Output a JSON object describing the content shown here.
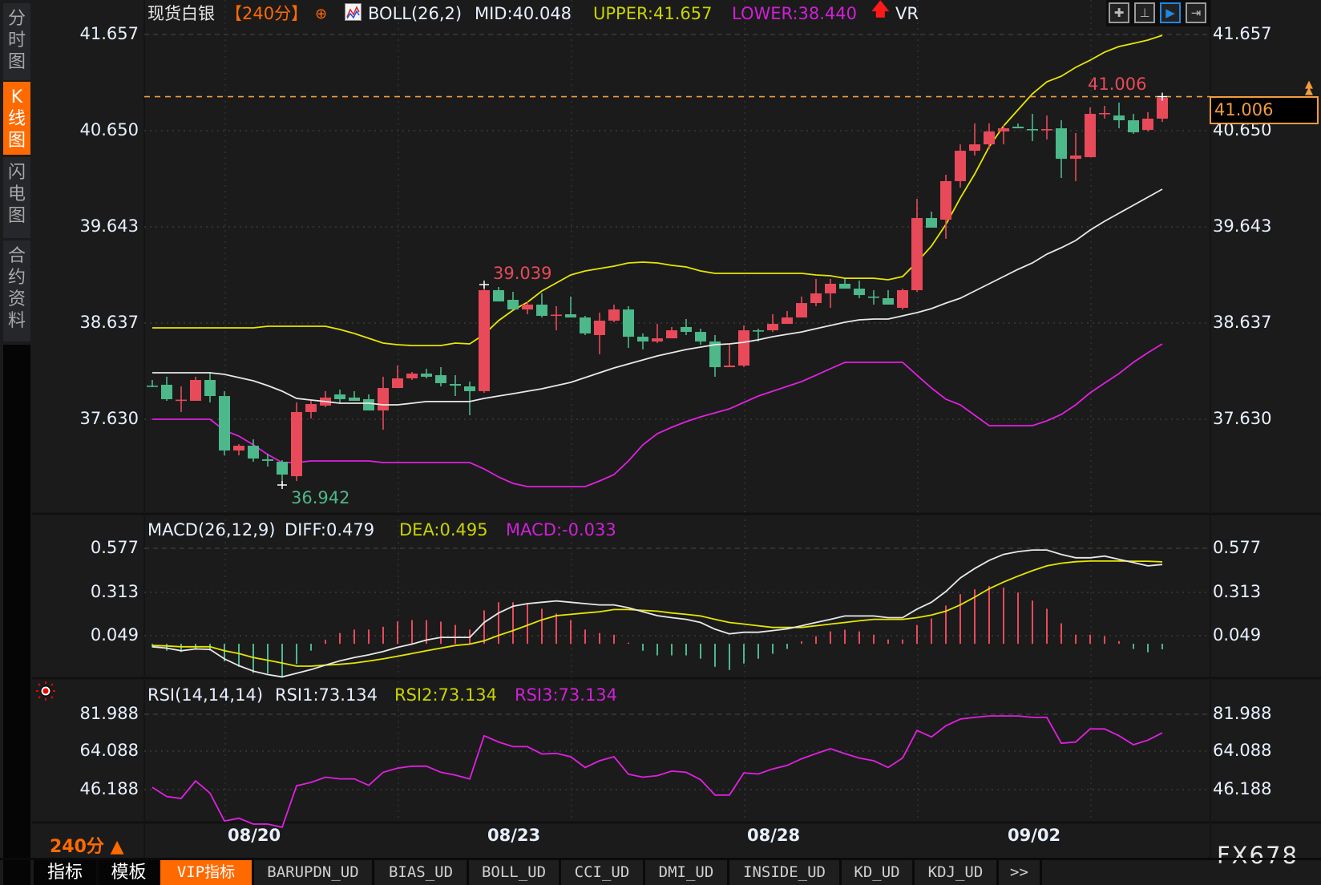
{
  "sidebar": {
    "tabs": [
      {
        "label": "分时图",
        "active": false
      },
      {
        "label": "K线图",
        "active": true
      },
      {
        "label": "闪电图",
        "active": false
      },
      {
        "label": "合约资料",
        "active": false
      }
    ]
  },
  "header": {
    "symbol": "现货白银",
    "period": "【240分】",
    "indicator": "BOLL(26,2)",
    "mid": "MID:40.048",
    "upper": "UPPER:41.657",
    "lower": "LOWER:38.440",
    "extra": "VR"
  },
  "toolbar_icons": [
    "crosshair-icon",
    "zoom-fit-icon",
    "auto-scroll-icon",
    "move-right-icon"
  ],
  "toolbar_active": 2,
  "price_tag": "41.006",
  "colors": {
    "background": "#1b1b1b",
    "up": "#e84a5a",
    "down": "#4db88a",
    "mid": "#e8e8e8",
    "upper": "#e6e600",
    "lower": "#e020e0",
    "accent": "#ff6a00",
    "price_line": "#f39c3c"
  },
  "macd_header": {
    "name": "MACD(26,12,9)",
    "diff": "DIFF:0.479",
    "dea": "DEA:0.495",
    "macd": "MACD:-0.033"
  },
  "rsi_header": {
    "name": "RSI(14,14,14)",
    "rsi1": "RSI1:73.134",
    "rsi2": "RSI2:73.134",
    "rsi3": "RSI3:73.134"
  },
  "chart_data": [
    {
      "type": "candlestick",
      "price_ticks": [
        "41.657",
        "40.650",
        "39.643",
        "38.637",
        "37.630"
      ],
      "ylim": [
        37.63,
        41.657
      ],
      "x_labels": [
        "08/20",
        "08/23",
        "08/28",
        "09/02"
      ],
      "last_price": 41.006,
      "annotations": {
        "high_1": "39.039",
        "low": "36.942",
        "high_2": "41.006"
      },
      "candles": [
        [
          37.982,
          38.041,
          37.966,
          37.975
        ],
        [
          37.991,
          38.075,
          37.823,
          37.84
        ],
        [
          37.831,
          37.974,
          37.706,
          37.835
        ],
        [
          37.823,
          38.075,
          37.823,
          38.041
        ],
        [
          38.041,
          38.125,
          37.806,
          37.873
        ],
        [
          37.873,
          37.924,
          37.252,
          37.303
        ],
        [
          37.303,
          37.37,
          37.252,
          37.353
        ],
        [
          37.353,
          37.42,
          37.185,
          37.219
        ],
        [
          37.211,
          37.269,
          37.135,
          37.194
        ],
        [
          37.185,
          37.202,
          36.942,
          37.051
        ],
        [
          37.034,
          37.806,
          36.984,
          37.706
        ],
        [
          37.706,
          37.823,
          37.638,
          37.789
        ],
        [
          37.773,
          37.924,
          37.756,
          37.857
        ],
        [
          37.89,
          37.94,
          37.806,
          37.84
        ],
        [
          37.857,
          37.924,
          37.823,
          37.823
        ],
        [
          37.84,
          37.89,
          37.722,
          37.722
        ],
        [
          37.722,
          38.075,
          37.521,
          37.957
        ],
        [
          37.957,
          38.192,
          37.957,
          38.058
        ],
        [
          38.058,
          38.125,
          38.041,
          38.108
        ],
        [
          38.108,
          38.159,
          38.058,
          38.075
        ],
        [
          38.091,
          38.175,
          37.974,
          38.008
        ],
        [
          37.999,
          38.091,
          37.873,
          37.982
        ],
        [
          37.974,
          38.024,
          37.672,
          37.924
        ],
        [
          37.924,
          39.039,
          37.907,
          38.981
        ],
        [
          38.981,
          39.014,
          38.863,
          38.863
        ],
        [
          38.88,
          38.964,
          38.779,
          38.779
        ],
        [
          38.779,
          38.863,
          38.729,
          38.83
        ],
        [
          38.83,
          38.947,
          38.695,
          38.712
        ],
        [
          38.721,
          38.813,
          38.561,
          38.725
        ],
        [
          38.729,
          38.914,
          38.695,
          38.695
        ],
        [
          38.695,
          38.712,
          38.511,
          38.528
        ],
        [
          38.511,
          38.746,
          38.31,
          38.662
        ],
        [
          38.662,
          38.83,
          38.645,
          38.779
        ],
        [
          38.779,
          38.813,
          38.377,
          38.494
        ],
        [
          38.494,
          38.528,
          38.36,
          38.444
        ],
        [
          38.444,
          38.628,
          38.427,
          38.477
        ],
        [
          38.477,
          38.595,
          38.477,
          38.561
        ],
        [
          38.595,
          38.679,
          38.511,
          38.544
        ],
        [
          38.544,
          38.578,
          38.41,
          38.444
        ],
        [
          38.444,
          38.511,
          38.075,
          38.175
        ],
        [
          38.175,
          38.41,
          38.175,
          38.192
        ],
        [
          38.192,
          38.612,
          38.175,
          38.561
        ],
        [
          38.561,
          38.578,
          38.444,
          38.553
        ],
        [
          38.561,
          38.729,
          38.544,
          38.628
        ],
        [
          38.628,
          38.763,
          38.628,
          38.695
        ],
        [
          38.695,
          38.914,
          38.695,
          38.846
        ],
        [
          38.846,
          39.098,
          38.813,
          38.947
        ],
        [
          38.947,
          39.098,
          38.796,
          39.048
        ],
        [
          39.048,
          39.098,
          38.997,
          38.997
        ],
        [
          38.997,
          39.081,
          38.897,
          38.93
        ],
        [
          38.914,
          38.981,
          38.83,
          38.91
        ],
        [
          38.897,
          38.981,
          38.83,
          38.83
        ],
        [
          38.796,
          38.997,
          38.779,
          38.981
        ],
        [
          38.981,
          39.937,
          38.964,
          39.736
        ],
        [
          39.736,
          39.803,
          39.635,
          39.635
        ],
        [
          39.719,
          40.189,
          39.518,
          40.122
        ],
        [
          40.122,
          40.507,
          40.054,
          40.44
        ],
        [
          40.44,
          40.726,
          40.39,
          40.507
        ],
        [
          40.507,
          40.726,
          40.457,
          40.642
        ],
        [
          40.642,
          40.709,
          40.507,
          40.675
        ],
        [
          40.692,
          40.726,
          40.675,
          40.675
        ],
        [
          40.667,
          40.826,
          40.541,
          40.662
        ],
        [
          40.662,
          40.809,
          40.558,
          40.667
        ],
        [
          40.675,
          40.759,
          40.155,
          40.356
        ],
        [
          40.356,
          40.625,
          40.122,
          40.39
        ],
        [
          40.373,
          40.893,
          40.373,
          40.826
        ],
        [
          40.83,
          40.91,
          40.776,
          40.835
        ],
        [
          40.809,
          40.944,
          40.675,
          40.759
        ],
        [
          40.759,
          40.826,
          40.617,
          40.633
        ],
        [
          40.658,
          40.843,
          40.642,
          40.776
        ],
        [
          40.776,
          41.006,
          40.742,
          40.994
        ]
      ],
      "boll_upper": [
        38.586,
        38.586,
        38.586,
        38.586,
        38.586,
        38.586,
        38.586,
        38.586,
        38.603,
        38.603,
        38.603,
        38.603,
        38.603,
        38.57,
        38.528,
        38.477,
        38.427,
        38.41,
        38.402,
        38.402,
        38.402,
        38.427,
        38.419,
        38.519,
        38.662,
        38.771,
        38.855,
        38.972,
        39.056,
        39.14,
        39.182,
        39.207,
        39.232,
        39.266,
        39.274,
        39.266,
        39.241,
        39.224,
        39.182,
        39.157,
        39.157,
        39.157,
        39.157,
        39.157,
        39.157,
        39.157,
        39.14,
        39.132,
        39.106,
        39.106,
        39.106,
        39.09,
        39.123,
        39.274,
        39.442,
        39.669,
        39.945,
        40.197,
        40.482,
        40.7,
        40.868,
        41.036,
        41.162,
        41.22,
        41.313,
        41.388,
        41.472,
        41.531,
        41.564,
        41.598,
        41.648
      ],
      "boll_mid": [
        38.117,
        38.117,
        38.117,
        38.117,
        38.117,
        38.1,
        38.066,
        38.033,
        37.982,
        37.924,
        37.848,
        37.831,
        37.815,
        37.798,
        37.798,
        37.798,
        37.781,
        37.781,
        37.798,
        37.815,
        37.815,
        37.815,
        37.815,
        37.848,
        37.873,
        37.898,
        37.924,
        37.949,
        37.982,
        38.016,
        38.066,
        38.117,
        38.167,
        38.209,
        38.251,
        38.293,
        38.326,
        38.36,
        38.385,
        38.41,
        38.419,
        38.435,
        38.461,
        38.494,
        38.519,
        38.544,
        38.578,
        38.612,
        38.645,
        38.67,
        38.679,
        38.679,
        38.712,
        38.746,
        38.788,
        38.846,
        38.897,
        38.972,
        39.048,
        39.123,
        39.199,
        39.266,
        39.358,
        39.425,
        39.501,
        39.61,
        39.702,
        39.786,
        39.87,
        39.954,
        40.038
      ],
      "boll_lower": [
        37.63,
        37.63,
        37.63,
        37.63,
        37.63,
        37.513,
        37.454,
        37.362,
        37.261,
        37.177,
        37.177,
        37.194,
        37.194,
        37.194,
        37.194,
        37.194,
        37.177,
        37.177,
        37.177,
        37.177,
        37.177,
        37.177,
        37.177,
        37.11,
        37.026,
        36.959,
        36.925,
        36.925,
        36.925,
        36.925,
        36.925,
        36.984,
        37.051,
        37.194,
        37.362,
        37.479,
        37.546,
        37.605,
        37.655,
        37.697,
        37.739,
        37.806,
        37.873,
        37.924,
        37.974,
        38.024,
        38.091,
        38.159,
        38.226,
        38.226,
        38.226,
        38.226,
        38.226,
        38.091,
        37.957,
        37.84,
        37.781,
        37.672,
        37.563,
        37.563,
        37.563,
        37.563,
        37.613,
        37.68,
        37.781,
        37.907,
        38.008,
        38.108,
        38.226,
        38.326,
        38.419
      ]
    },
    {
      "type": "bar",
      "name": "MACD(26,12,9)",
      "ticks": [
        "0.577",
        "0.313",
        "0.049"
      ],
      "macd": [
        -0.021,
        -0.041,
        -0.049,
        -0.033,
        -0.041,
        -0.106,
        -0.139,
        -0.176,
        -0.179,
        -0.204,
        -0.122,
        -0.041,
        0.024,
        0.065,
        0.086,
        0.086,
        0.103,
        0.135,
        0.143,
        0.143,
        0.134,
        0.114,
        0.086,
        0.202,
        0.251,
        0.251,
        0.241,
        0.212,
        0.183,
        0.143,
        0.086,
        0.065,
        0.055,
        0.007,
        -0.042,
        -0.07,
        -0.07,
        -0.07,
        -0.09,
        -0.139,
        -0.158,
        -0.119,
        -0.09,
        -0.06,
        -0.031,
        0.015,
        0.046,
        0.075,
        0.085,
        0.075,
        0.055,
        0.026,
        0.026,
        0.114,
        0.153,
        0.231,
        0.3,
        0.329,
        0.349,
        0.339,
        0.31,
        0.261,
        0.212,
        0.124,
        0.055,
        0.055,
        0.046,
        0.016,
        -0.031,
        -0.051,
        -0.033
      ],
      "diff": [
        -0.018,
        -0.026,
        -0.042,
        -0.031,
        -0.034,
        -0.091,
        -0.132,
        -0.165,
        -0.186,
        -0.2,
        -0.178,
        -0.156,
        -0.129,
        -0.103,
        -0.083,
        -0.067,
        -0.047,
        -0.021,
        -0.002,
        0.023,
        0.039,
        0.039,
        0.039,
        0.129,
        0.186,
        0.227,
        0.243,
        0.251,
        0.259,
        0.251,
        0.243,
        0.235,
        0.235,
        0.218,
        0.194,
        0.17,
        0.158,
        0.148,
        0.129,
        0.088,
        0.06,
        0.07,
        0.07,
        0.08,
        0.09,
        0.109,
        0.129,
        0.148,
        0.168,
        0.168,
        0.168,
        0.158,
        0.158,
        0.21,
        0.251,
        0.316,
        0.398,
        0.455,
        0.504,
        0.54,
        0.557,
        0.567,
        0.567,
        0.54,
        0.52,
        0.52,
        0.53,
        0.51,
        0.491,
        0.471,
        0.479
      ],
      "dea": [
        -0.01,
        -0.013,
        -0.018,
        -0.018,
        -0.018,
        -0.042,
        -0.059,
        -0.083,
        -0.099,
        -0.116,
        -0.135,
        -0.135,
        -0.129,
        -0.124,
        -0.116,
        -0.104,
        -0.091,
        -0.075,
        -0.059,
        -0.042,
        -0.026,
        -0.01,
        -0.002,
        0.018,
        0.051,
        0.08,
        0.112,
        0.145,
        0.17,
        0.178,
        0.186,
        0.194,
        0.207,
        0.207,
        0.202,
        0.197,
        0.186,
        0.178,
        0.168,
        0.148,
        0.129,
        0.119,
        0.109,
        0.099,
        0.099,
        0.099,
        0.109,
        0.119,
        0.129,
        0.139,
        0.148,
        0.148,
        0.148,
        0.158,
        0.174,
        0.197,
        0.235,
        0.282,
        0.333,
        0.373,
        0.409,
        0.442,
        0.471,
        0.487,
        0.496,
        0.5,
        0.5,
        0.5,
        0.499,
        0.499,
        0.495
      ]
    },
    {
      "type": "line",
      "name": "RSI(14,14,14)",
      "ticks": [
        "81.988",
        "64.088",
        "46.188"
      ],
      "rsi": [
        47.3,
        42.9,
        42.0,
        50.3,
        44.5,
        31.3,
        32.6,
        29.8,
        29.8,
        28.3,
        48.0,
        49.6,
        52.1,
        51.3,
        51.3,
        48.2,
        54.4,
        56.4,
        57.3,
        57.3,
        54.4,
        53.1,
        51.2,
        71.8,
        68.8,
        66.6,
        66.6,
        63.1,
        63.4,
        61.8,
        56.7,
        59.9,
        61.8,
        53.5,
        52.1,
        52.8,
        55.0,
        54.4,
        50.9,
        43.6,
        43.6,
        54.1,
        53.6,
        56.0,
        57.7,
        60.8,
        63.3,
        65.6,
        63.3,
        61.2,
        59.9,
        56.7,
        61.2,
        74.3,
        71.2,
        76.5,
        79.7,
        80.5,
        81.2,
        81.2,
        81.2,
        80.5,
        80.5,
        68.2,
        68.8,
        75.0,
        75.0,
        71.8,
        67.5,
        69.7,
        73.134
      ]
    }
  ],
  "bottom": {
    "period": "240分",
    "tabs": [
      {
        "label": "指标",
        "cn": true
      },
      {
        "label": "模板",
        "cn": true
      },
      {
        "label": "VIP指标",
        "active": true
      },
      {
        "label": "BARUPDN_UD"
      },
      {
        "label": "BIAS_UD"
      },
      {
        "label": "BOLL_UD"
      },
      {
        "label": "CCI_UD"
      },
      {
        "label": "DMI_UD"
      },
      {
        "label": "INSIDE_UD"
      },
      {
        "label": "KD_UD"
      },
      {
        "label": "KDJ_UD"
      },
      {
        "label": ">>"
      }
    ]
  },
  "watermark": "FX678"
}
